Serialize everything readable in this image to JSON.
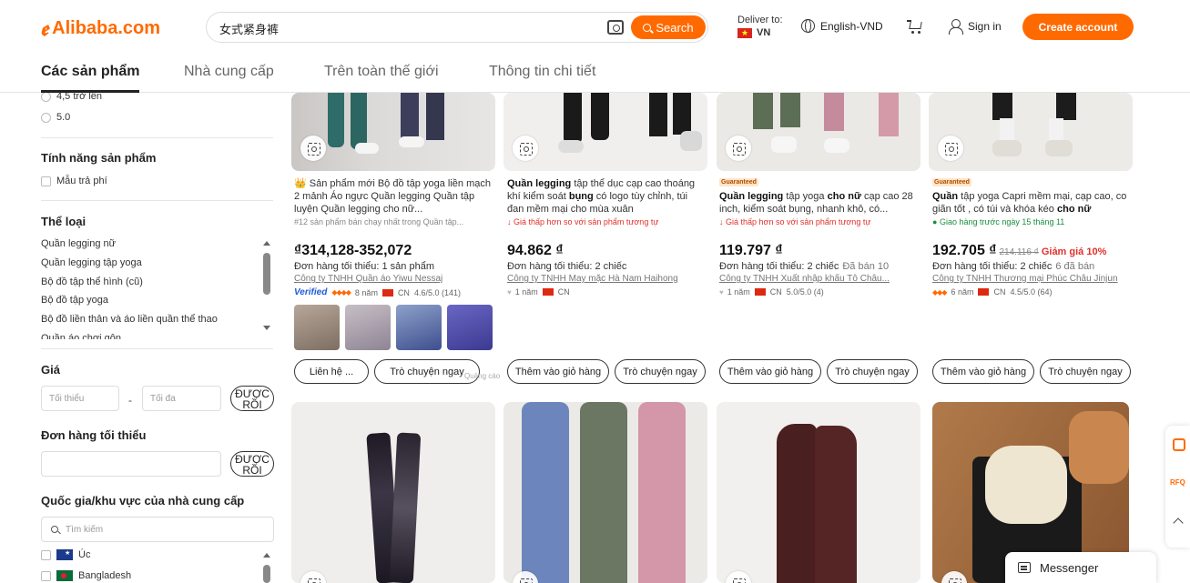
{
  "header": {
    "logo": "Alibaba.com",
    "search_value": "女式紧身裤",
    "search_label": "Search",
    "deliver_label": "Deliver to:",
    "deliver_country": "VN",
    "language": "English-VND",
    "signin": "Sign in",
    "create_account": "Create account"
  },
  "tabs": [
    "Các sản phẩm",
    "Nhà cung cấp",
    "Trên toàn thế giới",
    "Thông tin chi tiết"
  ],
  "sidebar": {
    "ratings": [
      "4,5 trở lên",
      "5.0"
    ],
    "features_title": "Tính năng sản phẩm",
    "features": [
      "Mẫu trả phí"
    ],
    "category_title": "Thể loại",
    "categories": [
      "Quần legging nữ",
      "Quần legging tập yoga",
      "Bộ đồ tập thể hình (cũ)",
      "Bộ đồ tập yoga",
      "Bộ đồ liền thân và áo liền quần thể thao",
      "Quần áo chơi gôn"
    ],
    "price_title": "Giá",
    "price_min_placeholder": "Tối thiểu",
    "price_max_placeholder": "Tối đa",
    "ok_label": "ĐƯỢC RỒI",
    "moq_title": "Đơn hàng tối thiểu",
    "country_title": "Quốc gia/khu vực của nhà cung cấp",
    "country_search_placeholder": "Tìm kiếm",
    "countries": [
      "Úc",
      "Bangladesh"
    ]
  },
  "products": [
    {
      "title_prefix": "👑 Sản phẩm mới Bộ đồ tập yoga liền mạch 2 mảnh Áo ngực Quần legging Quần tập luyện Quần legging cho nữ...",
      "tag": "#12 sản phẩm bán chạy nhất trong Quần tập...",
      "price": "₫314,128-352,072",
      "moq": "Đơn hàng tối thiểu: 1 sản phẩm",
      "supplier": "Công ty TNHH Quần áo Yiwu Nessaj",
      "verified": "Verified",
      "years": "8 năm",
      "country": "CN",
      "rating": "4.6/5.0 (141)",
      "btn1": "Liên hệ ...",
      "btn2": "Trò chuyện ngay",
      "note": "Quảng cáo"
    },
    {
      "title_bold": "Quần legging",
      "title_rest_a": " tập thể dục cạp cao thoáng khí kiểm soát ",
      "title_bold2": "bụng",
      "title_rest_b": " có logo tùy chỉnh, túi đan mềm mại cho mùa xuân",
      "tag": "Giá thấp hơn so với sản phẩm tương tự",
      "price": "94.862 ₫",
      "moq": "Đơn hàng tối thiểu: 2 chiếc",
      "supplier": "Công ty TNHH May mặc Hà Nam Haihong",
      "years": "1 năm",
      "country": "CN",
      "btn1": "Thêm vào giỏ hàng",
      "btn2": "Trò chuyện ngay"
    },
    {
      "badge": "Guaranteed",
      "title_bold": "Quần legging",
      "title_rest_a": " tập yoga ",
      "title_bold2": "cho nữ",
      "title_rest_b": " cạp cao 28 inch, kiểm soát bụng, nhanh khô, có...",
      "tag": "Giá thấp hơn so với sản phẩm tương tự",
      "price": "119.797 ₫",
      "moq": "Đơn hàng tối thiểu: 2 chiếc",
      "sold": "Đã bán 10",
      "supplier": "Công ty TNHH Xuất nhập khẩu Tô Châu...",
      "years": "1 năm",
      "country": "CN",
      "rating": "5.0/5.0 (4)",
      "btn1": "Thêm vào giỏ hàng",
      "btn2": "Trò chuyện ngay"
    },
    {
      "badge": "Guaranteed",
      "title_bold": "Quần",
      "title_rest_a": " tập yoga Capri mềm mại, cạp cao, co giãn tốt , có túi và khóa kéo ",
      "title_bold2": "cho nữ",
      "title_rest_b": "",
      "tag": "Giao hàng trước ngày 15 tháng 11",
      "price": "192.705 ₫",
      "price_old": "214.116 ₫",
      "discount": "Giảm giá 10%",
      "moq": "Đơn hàng tối thiểu: 2 chiếc",
      "sold": "6 đã bán",
      "supplier": "Công ty TNHH Thương mại Phúc Châu Jinjun",
      "years": "6 năm",
      "country": "CN",
      "rating": "4.5/5.0 (64)",
      "btn1": "Thêm vào giỏ hàng",
      "btn2": "Trò chuyện ngay"
    }
  ],
  "floating": {
    "rfq": "RFQ",
    "messenger": "Messenger"
  },
  "colors": {
    "accent": "#ff6a00",
    "text": "#222222"
  }
}
